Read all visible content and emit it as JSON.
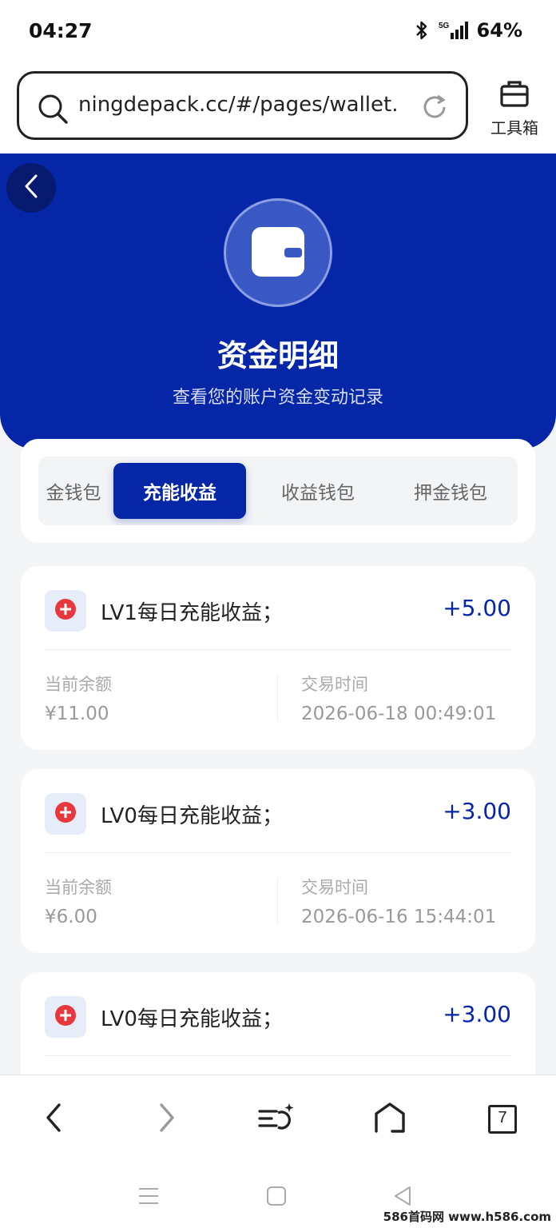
{
  "status": {
    "time": "04:27",
    "network": "5G",
    "battery": "64%"
  },
  "browser": {
    "url": "ningdepack.cc/#/pages/wallet...",
    "toolbox_label": "工具箱",
    "tab_count": "7"
  },
  "header": {
    "title": "资金明细",
    "subtitle": "查看您的账户资金变动记录"
  },
  "tabs": [
    {
      "label": "金钱包",
      "active": false
    },
    {
      "label": "充能收益",
      "active": true
    },
    {
      "label": "收益钱包",
      "active": false
    },
    {
      "label": "押金钱包",
      "active": false
    }
  ],
  "records": [
    {
      "title": "LV1每日充能收益；",
      "amount": "+5.00",
      "balance_label": "当前余额",
      "balance": "¥11.00",
      "time_label": "交易时间",
      "time": "2026-06-18 00:49:01"
    },
    {
      "title": "LV0每日充能收益；",
      "amount": "+3.00",
      "balance_label": "当前余额",
      "balance": "¥6.00",
      "time_label": "交易时间",
      "time": "2026-06-16 15:44:01"
    },
    {
      "title": "LV0每日充能收益；",
      "amount": "+3.00"
    }
  ],
  "watermark": "586首码网 www.h586.com",
  "colors": {
    "primary": "#0626a8",
    "accent_red": "#e8373d"
  }
}
